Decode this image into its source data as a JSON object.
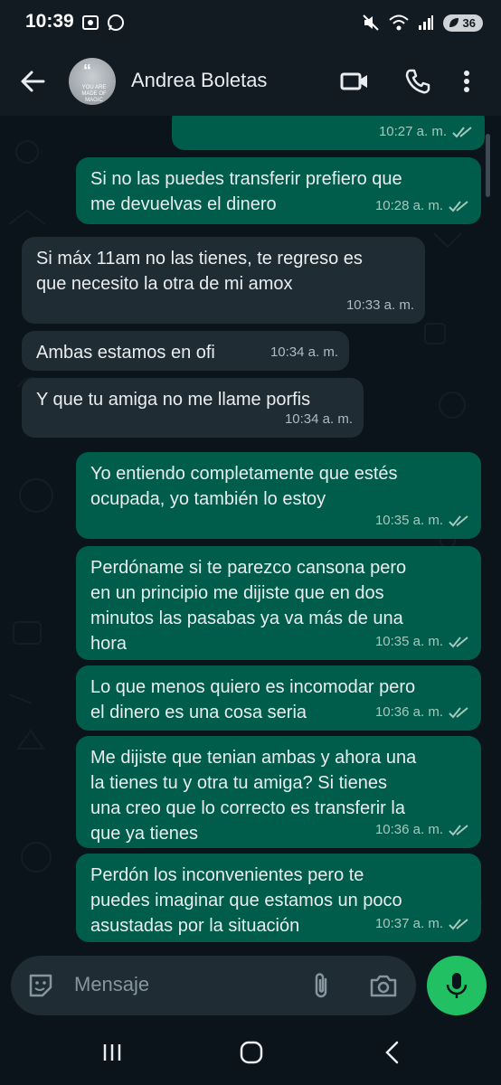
{
  "status_bar": {
    "time": "10:39",
    "battery": "36"
  },
  "header": {
    "contact_name": "Andrea Boletas",
    "avatar_text": "YOU ARE MADE OF MAGIC"
  },
  "messages": [
    {
      "direction": "out",
      "lines": [],
      "time": "10:27 a. m.",
      "read": true
    },
    {
      "direction": "out",
      "lines": [
        "Si no las puedes transferir prefiero que",
        "me devuelvas el dinero"
      ],
      "time": "10:28 a. m.",
      "read": true
    },
    {
      "direction": "in",
      "lines": [
        "Si máx 11am no las tienes, te regreso es",
        "que necesito la otra de mi amox"
      ],
      "time": "10:33 a. m."
    },
    {
      "direction": "in",
      "lines": [
        "Ambas estamos en ofi"
      ],
      "time": "10:34 a. m."
    },
    {
      "direction": "in",
      "lines": [
        "Y que tu amiga no me llame porfis"
      ],
      "time": "10:34 a. m."
    },
    {
      "direction": "out",
      "lines": [
        "Yo entiendo completamente que estés",
        "ocupada, yo también lo estoy"
      ],
      "time": "10:35 a. m.",
      "read": true
    },
    {
      "direction": "out",
      "lines": [
        "Perdóname si te parezco cansona pero",
        "en un principio me dijiste que en dos",
        "minutos las pasabas ya va más de una",
        "hora"
      ],
      "time": "10:35 a. m.",
      "read": true
    },
    {
      "direction": "out",
      "lines": [
        "Lo que menos quiero es incomodar pero",
        "el dinero es una cosa seria"
      ],
      "time": "10:36 a. m.",
      "read": true
    },
    {
      "direction": "out",
      "lines": [
        "Me dijiste que tenian ambas y ahora una",
        "la tienes tu y otra tu amiga? Si tienes",
        "una creo que lo correcto es transferir la",
        "que ya tienes"
      ],
      "time": "10:36 a. m.",
      "read": true
    },
    {
      "direction": "out",
      "lines": [
        "Perdón los inconvenientes pero te",
        "puedes imaginar que estamos un poco",
        "asustadas por la situación"
      ],
      "time": "10:37 a. m.",
      "read": true
    }
  ],
  "composer": {
    "placeholder": "Mensaje"
  },
  "colors": {
    "outgoing_bubble": "#005c4b",
    "incoming_bubble": "#202c33",
    "accent_green": "#21c063",
    "read_ticks": "#a8c7bd"
  }
}
